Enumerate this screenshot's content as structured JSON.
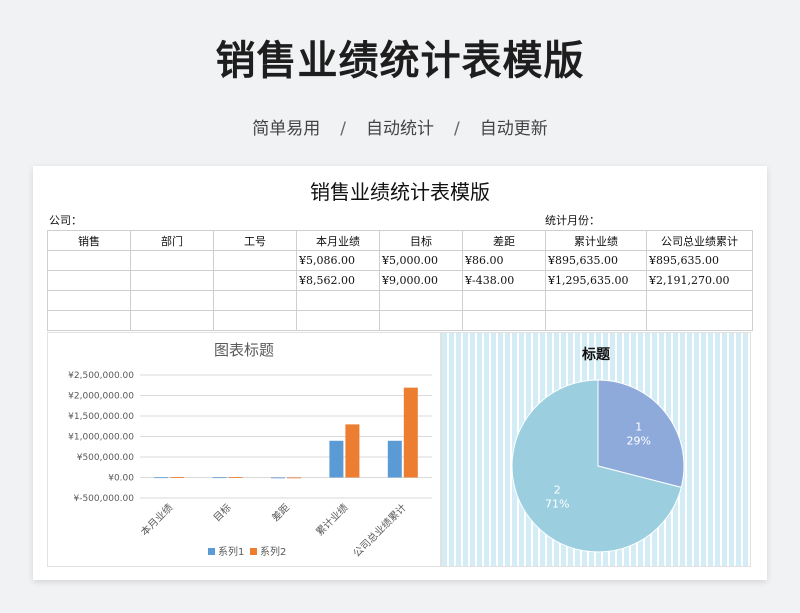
{
  "header": {
    "title": "销售业绩统计表模版",
    "subtitle_items": [
      "简单易用",
      "自动统计",
      "自动更新"
    ],
    "separator": "/"
  },
  "sheet": {
    "title": "销售业绩统计表模版",
    "company_label": "公司：",
    "month_label": "统计月份：",
    "columns": [
      "销售",
      "部门",
      "工号",
      "本月业绩",
      "目标",
      "差距",
      "累计业绩",
      "公司总业绩累计"
    ],
    "rows": [
      [
        "",
        "",
        "",
        "¥5,086.00",
        "¥5,000.00",
        "¥86.00",
        "¥895,635.00",
        "¥895,635.00"
      ],
      [
        "",
        "",
        "",
        "¥8,562.00",
        "¥9,000.00",
        "¥-438.00",
        "¥1,295,635.00",
        "¥2,191,270.00"
      ],
      [
        "",
        "",
        "",
        "",
        "",
        "",
        "",
        ""
      ],
      [
        "",
        "",
        "",
        "",
        "",
        "",
        "",
        ""
      ]
    ]
  },
  "colors": {
    "series1": "#5b9bd5",
    "series2": "#ed7d31",
    "pie_slice1": "#8eaadb",
    "pie_slice2": "#9bcfe0"
  },
  "chart_data": [
    {
      "type": "bar",
      "title": "图表标题",
      "categories": [
        "本月业绩",
        "目标",
        "差距",
        "累计业绩",
        "公司总业绩累计"
      ],
      "series": [
        {
          "name": "系列1",
          "values": [
            5086,
            5000,
            86,
            895635,
            895635
          ]
        },
        {
          "name": "系列2",
          "values": [
            8562,
            9000,
            -438,
            1295635,
            2191270
          ]
        }
      ],
      "yticks": [
        "¥2,500,000.00",
        "¥2,000,000.00",
        "¥1,500,000.00",
        "¥1,000,000.00",
        "¥500,000.00",
        "¥0.00",
        "¥-500,000.00"
      ],
      "ylim": [
        -500000,
        2500000
      ],
      "grid": true,
      "legend": "bottom",
      "xlabel": "",
      "ylabel": ""
    },
    {
      "type": "pie",
      "title": "标题",
      "labels": [
        "1",
        "2"
      ],
      "values": [
        29,
        71
      ],
      "percent_labels": [
        "29%",
        "71%"
      ]
    }
  ]
}
